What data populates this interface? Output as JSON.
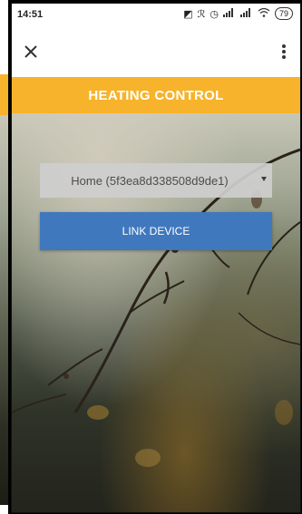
{
  "status_bar": {
    "time": "14:51",
    "battery": "79"
  },
  "app_bar": {
    "close_icon": "close-icon",
    "menu_icon": "more-vertical-icon"
  },
  "header": {
    "title": "HEATING CONTROL",
    "color": "#f7b32b"
  },
  "form": {
    "home_select": {
      "selected": "Home (5f3ea8d338508d9de1)"
    },
    "link_button": {
      "label": "LINK DEVICE",
      "color": "#3f78bd"
    }
  }
}
